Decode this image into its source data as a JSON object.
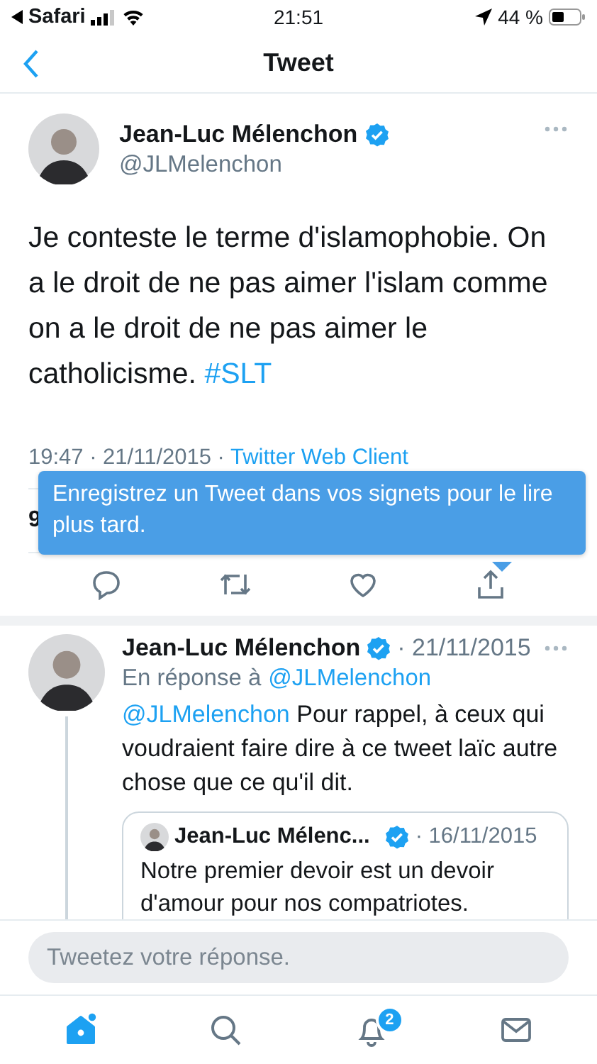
{
  "status_bar": {
    "back_app": "Safari",
    "time": "21:51",
    "battery": "44 %"
  },
  "header": {
    "title": "Tweet"
  },
  "tweet": {
    "author": "Jean-Luc Mélenchon",
    "verified": true,
    "handle": "@JLMelenchon",
    "text": [
      {
        "kind": "plain",
        "text": "Je conteste le terme d'islamophobie. On a le droit de ne pas aimer l'islam comme on a le droit de ne pas aimer le catholicisme. "
      },
      {
        "kind": "link",
        "text": "#SLT"
      }
    ],
    "timestamp": "19:47 · 21/11/2015 · ",
    "source": "Twitter Web Client",
    "stats_fragment": "9",
    "tooltip": "Enregistrez un Tweet dans vos signets pour le lire plus tard."
  },
  "reply": {
    "author": "Jean-Luc Mélenchon",
    "verified": true,
    "date": "· 21/11/2015",
    "in_reply_prefix": "En réponse à",
    "in_reply_handle": "@JLMelenchon",
    "text": [
      {
        "kind": "link",
        "text": "@JLMelenchon"
      },
      {
        "kind": "plain",
        "text": " Pour rappel, à ceux qui voudraient faire dire à ce tweet laïc autre chose que ce qu'il dit."
      }
    ],
    "quote": {
      "author": "Jean-Luc Mélenc...",
      "verified": true,
      "date": "· 16/11/2015",
      "text": "Notre premier devoir est un devoir d'amour pour nos compatriotes."
    }
  },
  "composer": {
    "placeholder": "Tweetez votre réponse."
  },
  "tab_bar": [
    {
      "kind": "home",
      "selected": true,
      "new": true
    },
    {
      "kind": "search",
      "selected": false
    },
    {
      "kind": "notifications",
      "selected": false,
      "badge": "2"
    },
    {
      "kind": "messages",
      "selected": false
    }
  ]
}
